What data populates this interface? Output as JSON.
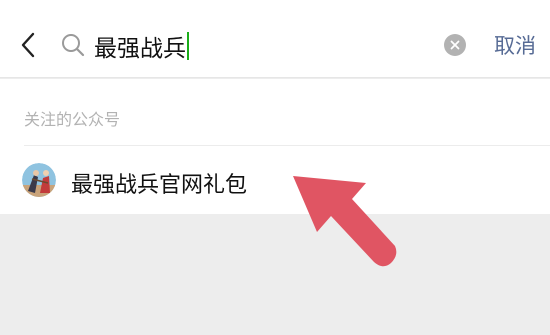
{
  "search": {
    "query": "最强战兵",
    "cancel_label": "取消"
  },
  "results": {
    "section_title": "关注的公众号",
    "items": [
      {
        "name": "最强战兵官网礼包"
      }
    ]
  },
  "colors": {
    "accent_link": "#576b95",
    "caret": "#1aad19",
    "annotation_arrow": "#e05563"
  },
  "icons": [
    "back-arrow-icon",
    "search-icon",
    "clear-icon",
    "avatar",
    "annotation-arrow"
  ]
}
